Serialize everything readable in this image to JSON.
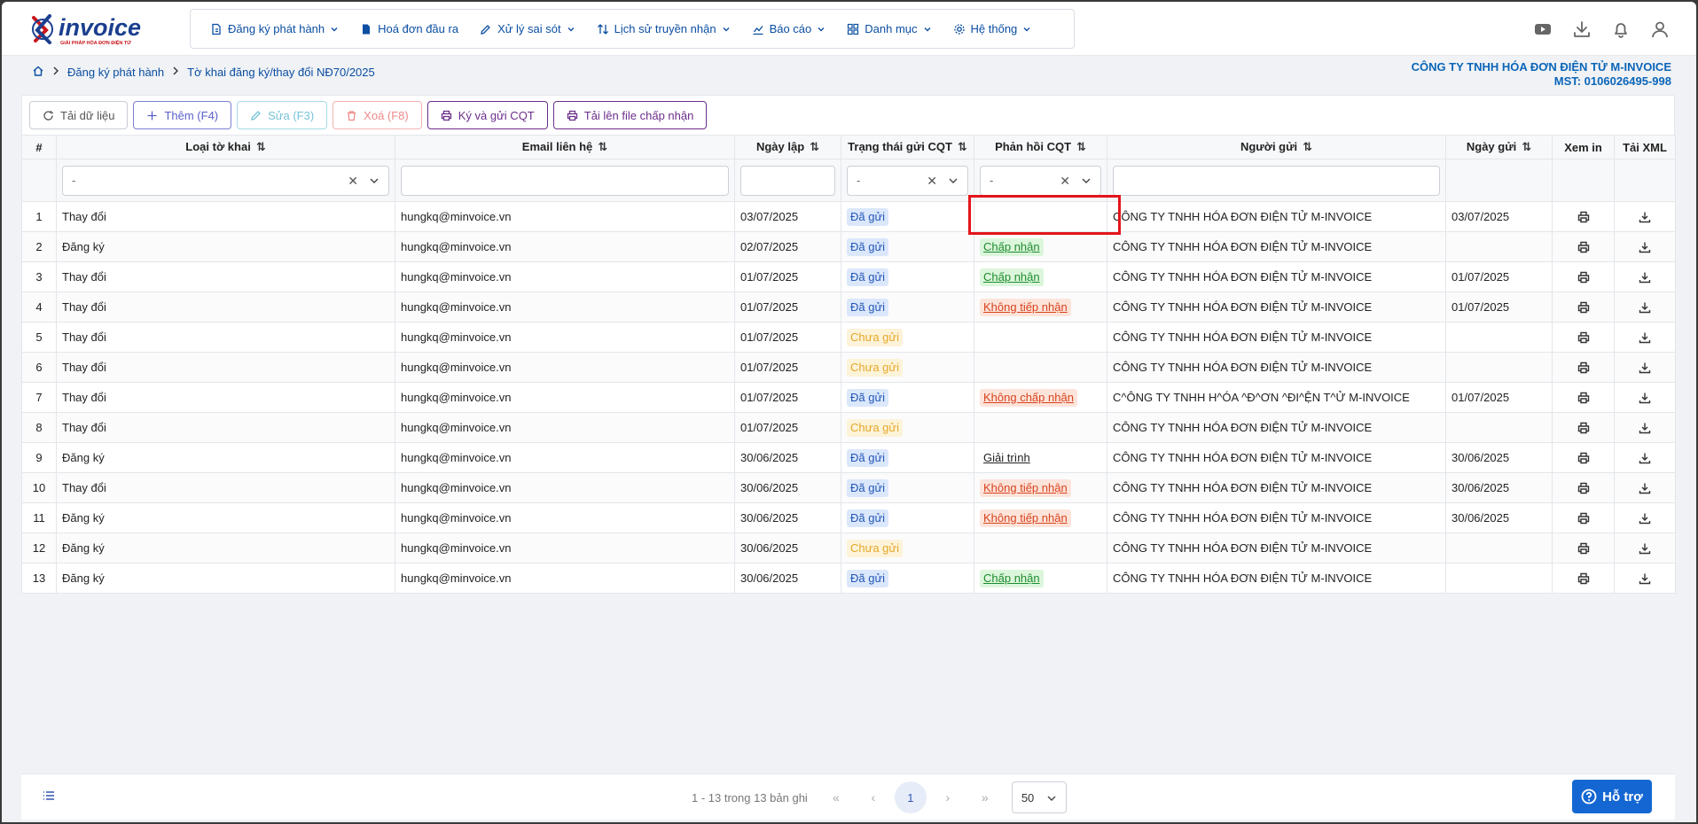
{
  "brand": {
    "name": "invoice",
    "tagline": "GIẢI PHÁP HÓA ĐƠN ĐIỆN TỬ"
  },
  "nav": [
    {
      "label": "Đăng ký phát hành",
      "icon": "file-register-icon",
      "dropdown": true
    },
    {
      "label": "Hoá đơn đầu ra",
      "icon": "file-icon",
      "dropdown": false
    },
    {
      "label": "Xử lý sai sót",
      "icon": "edit-icon",
      "dropdown": true
    },
    {
      "label": "Lịch sử truyền nhận",
      "icon": "transfer-icon",
      "dropdown": true
    },
    {
      "label": "Báo cáo",
      "icon": "chart-icon",
      "dropdown": true
    },
    {
      "label": "Danh mục",
      "icon": "grid-icon",
      "dropdown": true
    },
    {
      "label": "Hệ thống",
      "icon": "gear-icon",
      "dropdown": true
    }
  ],
  "header_icons": [
    "youtube-icon",
    "download-icon",
    "bell-icon",
    "user-icon"
  ],
  "breadcrumb": {
    "home_icon": "home-icon",
    "items": [
      "Đăng ký phát hành",
      "Tờ khai đăng ký/thay đổi NĐ70/2025"
    ]
  },
  "company": {
    "name": "CÔNG TY TNHH HÓA ĐƠN ĐIỆN TỬ M-INVOICE",
    "tax_code": "MST: 0106026495-998"
  },
  "toolbar": {
    "reload": "Tải dữ liệu",
    "add": "Thêm (F4)",
    "edit": "Sửa (F3)",
    "delete": "Xoá (F8)",
    "sign": "Ký và gửi CQT",
    "upload": "Tải lên file chấp nhận"
  },
  "table": {
    "headers": {
      "index": "#",
      "type": "Loại tờ khai",
      "email": "Email liên hệ",
      "date": "Ngày lập",
      "status": "Trạng thái gửi CQT",
      "response": "Phản hồi CQT",
      "sender": "Người gửi",
      "send_date": "Ngày gửi",
      "view": "Xem in",
      "xml": "Tải XML"
    },
    "filters": {
      "type": "-",
      "status": "-",
      "response": "-"
    },
    "rows": [
      {
        "no": "1",
        "type": "Thay đổi",
        "email": "hungkq@minvoice.vn",
        "date": "03/07/2025",
        "status": "Đã gửi",
        "status_kind": "sent",
        "response": "",
        "response_kind": "",
        "sender": "CÔNG TY TNHH HÓA ĐƠN ĐIỆN TỬ M-INVOICE",
        "send_date": "03/07/2025"
      },
      {
        "no": "2",
        "type": "Đăng ký",
        "email": "hungkq@minvoice.vn",
        "date": "02/07/2025",
        "status": "Đã gửi",
        "status_kind": "sent",
        "response": "Chấp nhận",
        "response_kind": "accept",
        "sender": "CÔNG TY TNHH HÓA ĐƠN ĐIỆN TỬ M-INVOICE",
        "send_date": ""
      },
      {
        "no": "3",
        "type": "Thay đổi",
        "email": "hungkq@minvoice.vn",
        "date": "01/07/2025",
        "status": "Đã gửi",
        "status_kind": "sent",
        "response": "Chấp nhận",
        "response_kind": "accept",
        "sender": "CÔNG TY TNHH HÓA ĐƠN ĐIỆN TỬ M-INVOICE",
        "send_date": "01/07/2025"
      },
      {
        "no": "4",
        "type": "Thay đổi",
        "email": "hungkq@minvoice.vn",
        "date": "01/07/2025",
        "status": "Đã gửi",
        "status_kind": "sent",
        "response": "Không tiếp nhận",
        "response_kind": "reject",
        "sender": "CÔNG TY TNHH HÓA ĐƠN ĐIỆN TỬ M-INVOICE",
        "send_date": "01/07/2025"
      },
      {
        "no": "5",
        "type": "Thay đổi",
        "email": "hungkq@minvoice.vn",
        "date": "01/07/2025",
        "status": "Chưa gửi",
        "status_kind": "unsent",
        "response": "",
        "response_kind": "",
        "sender": "CÔNG TY TNHH HÓA ĐƠN ĐIỆN TỬ M-INVOICE",
        "send_date": ""
      },
      {
        "no": "6",
        "type": "Thay đổi",
        "email": "hungkq@minvoice.vn",
        "date": "01/07/2025",
        "status": "Chưa gửi",
        "status_kind": "unsent",
        "response": "",
        "response_kind": "",
        "sender": "CÔNG TY TNHH HÓA ĐƠN ĐIỆN TỬ M-INVOICE",
        "send_date": ""
      },
      {
        "no": "7",
        "type": "Thay đổi",
        "email": "hungkq@minvoice.vn",
        "date": "01/07/2025",
        "status": "Đã gửi",
        "status_kind": "sent",
        "response": "Không chấp nhận",
        "response_kind": "reject",
        "sender": "C^ÔNG TY TNHH H^ÓA ^Đ^ƠN ^ĐI^ỆN T^Ử M-INVOICE",
        "send_date": "01/07/2025"
      },
      {
        "no": "8",
        "type": "Thay đổi",
        "email": "hungkq@minvoice.vn",
        "date": "01/07/2025",
        "status": "Chưa gửi",
        "status_kind": "unsent",
        "response": "",
        "response_kind": "",
        "sender": "CÔNG TY TNHH HÓA ĐƠN ĐIỆN TỬ M-INVOICE",
        "send_date": ""
      },
      {
        "no": "9",
        "type": "Đăng ký",
        "email": "hungkq@minvoice.vn",
        "date": "30/06/2025",
        "status": "Đã gửi",
        "status_kind": "sent",
        "response": "Giải trình",
        "response_kind": "explain",
        "sender": "CÔNG TY TNHH HÓA ĐƠN ĐIỆN TỬ M-INVOICE",
        "send_date": "30/06/2025"
      },
      {
        "no": "10",
        "type": "Thay đổi",
        "email": "hungkq@minvoice.vn",
        "date": "30/06/2025",
        "status": "Đã gửi",
        "status_kind": "sent",
        "response": "Không tiếp nhận",
        "response_kind": "reject",
        "sender": "CÔNG TY TNHH HÓA ĐƠN ĐIỆN TỬ M-INVOICE",
        "send_date": "30/06/2025"
      },
      {
        "no": "11",
        "type": "Đăng ký",
        "email": "hungkq@minvoice.vn",
        "date": "30/06/2025",
        "status": "Đã gửi",
        "status_kind": "sent",
        "response": "Không tiếp nhận",
        "response_kind": "reject",
        "sender": "CÔNG TY TNHH HÓA ĐƠN ĐIỆN TỬ M-INVOICE",
        "send_date": "30/06/2025"
      },
      {
        "no": "12",
        "type": "Đăng ký",
        "email": "hungkq@minvoice.vn",
        "date": "30/06/2025",
        "status": "Chưa gửi",
        "status_kind": "unsent",
        "response": "",
        "response_kind": "",
        "sender": "CÔNG TY TNHH HÓA ĐƠN ĐIỆN TỬ M-INVOICE",
        "send_date": ""
      },
      {
        "no": "13",
        "type": "Đăng ký",
        "email": "hungkq@minvoice.vn",
        "date": "30/06/2025",
        "status": "Đã gửi",
        "status_kind": "sent",
        "response": "Chấp nhận",
        "response_kind": "accept",
        "sender": "CÔNG TY TNHH HÓA ĐƠN ĐIỆN TỬ M-INVOICE",
        "send_date": ""
      }
    ]
  },
  "pagination": {
    "summary": "1 - 13 trong 13 bản ghi",
    "current_page": "1",
    "page_size": "50"
  },
  "support": {
    "label": "Hỗ trợ"
  },
  "colors": {
    "primary": "#0b4ea2",
    "accent": "#6b2e8a",
    "highlight": "#e3151b",
    "support": "#1467d2"
  }
}
